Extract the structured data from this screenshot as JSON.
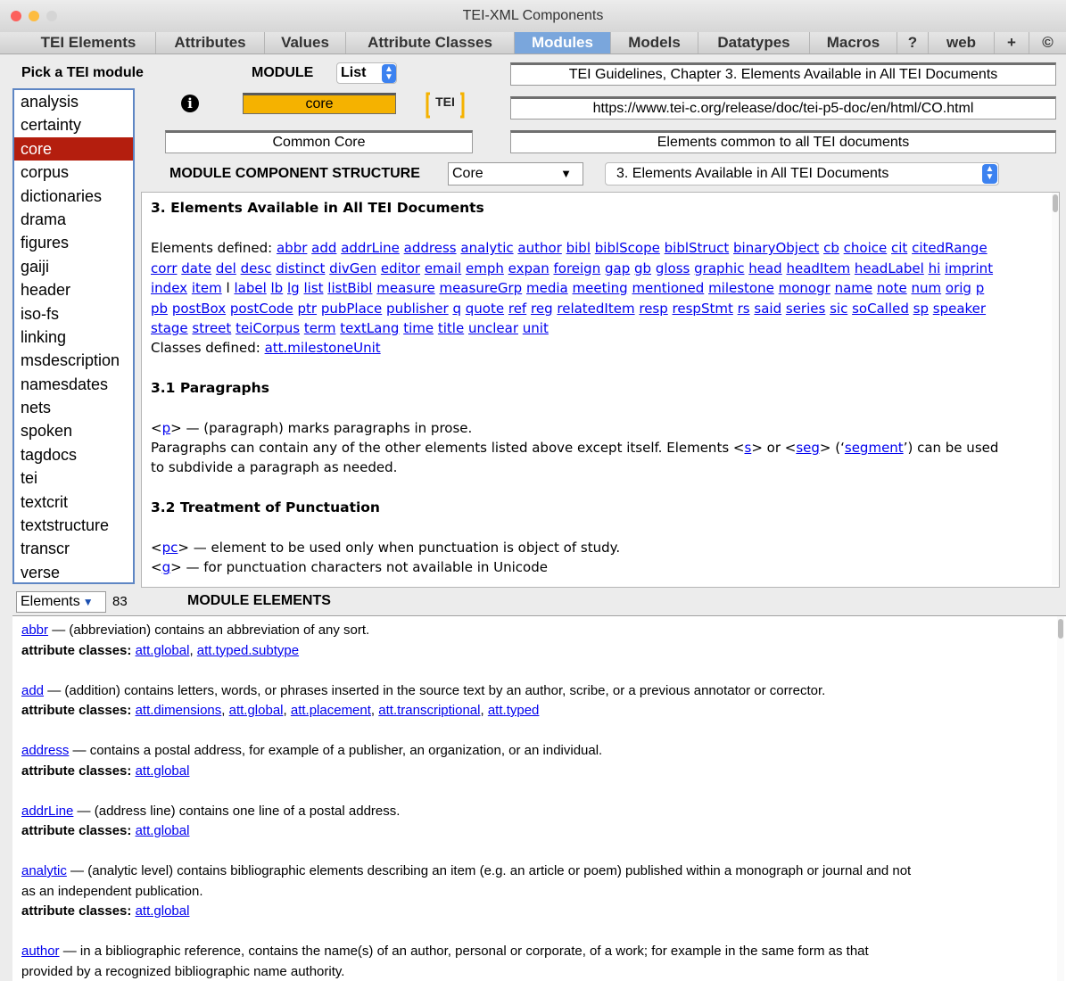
{
  "window": {
    "title": "TEI-XML Components"
  },
  "tabs": [
    "TEI Elements",
    "Attributes",
    "Values",
    "Attribute Classes",
    "Modules",
    "Models",
    "Datatypes",
    "Macros",
    "?",
    "web",
    "+",
    "©"
  ],
  "active_tab": "Modules",
  "sidebar": {
    "label": "Pick a TEI module",
    "modules": [
      "analysis",
      "certainty",
      "core",
      "corpus",
      "dictionaries",
      "drama",
      "figures",
      "gaiji",
      "header",
      "iso-fs",
      "linking",
      "msdescription",
      "namesdates",
      "nets",
      "spoken",
      "tagdocs",
      "tei",
      "textcrit",
      "textstructure",
      "transcr",
      "verse"
    ],
    "selected": "core"
  },
  "module_header": {
    "label": "MODULE",
    "view_select": "List",
    "current_module": "core",
    "module_fullname": "Common Core",
    "logo_text": "TEI",
    "chapter_title": "TEI Guidelines, Chapter 3. Elements Available in All TEI Documents",
    "chapter_url": "https://www.tei-c.org/release/doc/tei-p5-doc/en/html/CO.html",
    "description": "Elements common to all TEI documents",
    "structure_label": "MODULE COMPONENT STRUCTURE",
    "structure_select": "Core",
    "section_select": "3. Elements Available in All TEI Documents"
  },
  "doc": {
    "heading": "3. Elements Available in All TEI Documents",
    "elements_label": "Elements defined:",
    "elements_lines": [
      [
        "abbr",
        "add",
        "addrLine",
        "address",
        "analytic",
        "author",
        "bibl",
        "biblScope",
        "biblStruct",
        "binaryObject",
        "cb",
        "choice",
        "cit",
        "citedRange"
      ],
      [
        "corr",
        "date",
        "del",
        "desc",
        "distinct",
        "divGen",
        "editor",
        "email",
        "emph",
        "expan",
        "foreign",
        "gap",
        "gb",
        "gloss",
        "graphic",
        "head",
        "headItem",
        "headLabel",
        "hi",
        "imprint"
      ],
      [
        "index",
        "item",
        "l",
        "label",
        "lb",
        "lg",
        "list",
        "listBibl",
        "measure",
        "measureGrp",
        "media",
        "meeting",
        "mentioned",
        "milestone",
        "monogr",
        "name",
        "note",
        "num",
        "orig",
        "p"
      ],
      [
        "pb",
        "postBox",
        "postCode",
        "ptr",
        "pubPlace",
        "publisher",
        "q",
        "quote",
        "ref",
        "reg",
        "relatedItem",
        "resp",
        "respStmt",
        "rs",
        "said",
        "series",
        "sic",
        "soCalled",
        "sp",
        "speaker"
      ],
      [
        "stage",
        "street",
        "teiCorpus",
        "term",
        "textLang",
        "time",
        "title",
        "unclear",
        "unit"
      ]
    ],
    "unlinked_elements": [
      "l"
    ],
    "classes_label": "Classes defined:",
    "classes": [
      "att.milestoneUnit"
    ],
    "s1_heading": "3.1 Paragraphs",
    "s1_p_tag": "p",
    "s1_p_desc": " — (paragraph) marks paragraphs in prose.",
    "s1_text_a": "Paragraphs can contain any of the other elements listed above except itself. Elements <",
    "s1_tag_s": "s",
    "s1_text_b": "> or <",
    "s1_tag_seg": "seg",
    "s1_text_c": "> (‘",
    "s1_segment": "segment",
    "s1_text_d": "’) can be used",
    "s1_text_e": "to subdivide a paragraph as needed.",
    "s2_heading": "3.2 Treatment of Punctuation",
    "s2_pc_tag": "pc",
    "s2_pc_desc": " — element to be used only when punctuation is object of study.",
    "s2_g_tag": "g",
    "s2_g_desc": " — for punctuation characters not available in Unicode"
  },
  "elements_bar": {
    "select": "Elements",
    "count": "83",
    "label": "MODULE ELEMENTS"
  },
  "element_list": [
    {
      "name": "abbr",
      "desc": " — (abbreviation) contains an abbreviation of any sort.",
      "classes": [
        "att.global",
        "att.typed.subtype"
      ]
    },
    {
      "name": "add",
      "desc": " — (addition) contains letters, words, or phrases inserted in the source text by an author, scribe, or a previous annotator or corrector.",
      "classes": [
        "att.dimensions",
        "att.global",
        "att.placement",
        "att.transcriptional",
        "att.typed"
      ]
    },
    {
      "name": "address",
      "desc": " — contains a postal address, for example of a publisher, an organization, or an individual.",
      "classes": [
        "att.global"
      ]
    },
    {
      "name": "addrLine",
      "desc": " — (address line) contains one line of a postal address.",
      "classes": [
        "att.global"
      ]
    },
    {
      "name": "analytic",
      "desc": " — (analytic level) contains bibliographic elements describing an item (e.g. an article or poem) published within a monograph or journal and not",
      "desc2": "as an independent publication.",
      "classes": [
        "att.global"
      ]
    },
    {
      "name": "author",
      "desc": " — in a bibliographic reference, contains the name(s) of an author, personal or corporate, of a work; for example in the same form as that",
      "desc2": "provided by a recognized bibliographic name authority.",
      "classes": []
    }
  ],
  "attr_classes_label": "attribute classes:",
  "colors": {
    "accent": "#7aa6dc",
    "selection": "#b41e0e",
    "core_box": "#f5b200",
    "link": "#0000ee"
  }
}
